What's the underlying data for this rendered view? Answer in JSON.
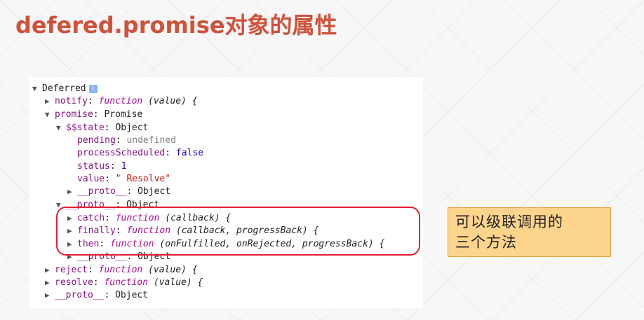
{
  "slide": {
    "title": "defered.promise对象的属性"
  },
  "console": {
    "deferred_label": "Deferred",
    "info_icon": "i",
    "notify": {
      "key": "notify",
      "kw": "function",
      "sig": "(value) {"
    },
    "promise": {
      "key": "promise",
      "value": "Promise"
    },
    "state": {
      "key": "$$state",
      "value": "Object"
    },
    "pending": {
      "key": "pending",
      "value": "undefined"
    },
    "processScheduled": {
      "key": "processScheduled",
      "value": "false"
    },
    "status": {
      "key": "status",
      "value": "1"
    },
    "value": {
      "key": "value",
      "value": "\" Resolve\""
    },
    "proto_state": {
      "key": "__proto__",
      "value": "Object"
    },
    "proto_promise": {
      "key": "__proto__",
      "value": "Object"
    },
    "catch": {
      "key": "catch",
      "kw": "function",
      "sig": "(callback) {"
    },
    "finally": {
      "key": "finally",
      "kw": "function",
      "sig": "(callback, progressBack) {"
    },
    "then": {
      "key": "then",
      "kw": "function",
      "sig": "(onFulfilled, onRejected, progressBack) {"
    },
    "proto_inner": {
      "key": "__proto__",
      "value": "Object"
    },
    "reject": {
      "key": "reject",
      "kw": "function",
      "sig": "(value) {"
    },
    "resolve": {
      "key": "resolve",
      "kw": "function",
      "sig": "(value) {"
    },
    "proto_deferred": {
      "key": "__proto__",
      "value": "Object"
    }
  },
  "callout": {
    "line1": "可以级联调用的",
    "line2": "三个方法"
  },
  "colors": {
    "title": "#d0523a",
    "highlight": "#e0202e",
    "callout_bg": "#fdd48c"
  },
  "icons": [
    "expanded-arrow-icon",
    "collapsed-arrow-icon",
    "info-icon"
  ]
}
